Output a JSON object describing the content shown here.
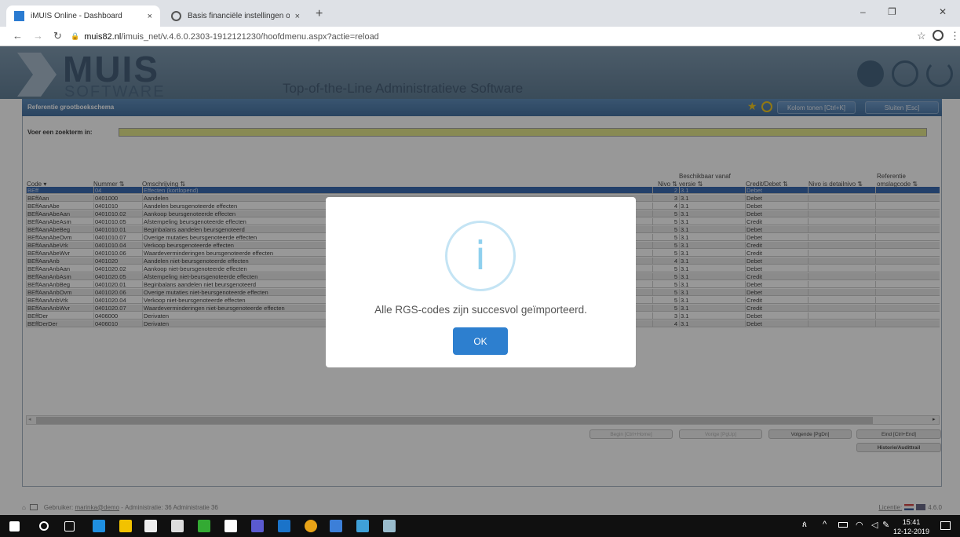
{
  "browser": {
    "tabs": [
      {
        "title": "iMUIS Online - Dashboard",
        "close": "×"
      },
      {
        "title": "Basis financiële instellingen oph",
        "close": "×"
      }
    ],
    "new_tab": "+",
    "url_host": "muis82.nl",
    "url_path": "/imuis_net/v.4.6.0.2303-1912121230/hoofdmenu.aspx?actie=reload",
    "window_controls": [
      "–",
      "❐",
      "✕"
    ]
  },
  "app": {
    "logo_main": "MUIS",
    "logo_sub": "SOFTWARE",
    "slogan": "Top-of-the-Line Administratieve Software"
  },
  "window": {
    "title": "Referentie grootboekschema",
    "show_columns_label": "Kolom tonen [Ctrl+K]",
    "close_label": "Sluiten [Esc]",
    "search_label": "Voer een zoekterm in:",
    "search_value": ""
  },
  "table": {
    "columns": [
      {
        "label": "Code ▾"
      },
      {
        "label": "Nummer ⇅"
      },
      {
        "label": "Omschrijving ⇅"
      },
      {
        "label": "Nivo ⇅"
      },
      {
        "label": "Beschikbaar vanaf versie ⇅"
      },
      {
        "label": "Credit/Debet ⇅"
      },
      {
        "label": "Nivo is detailnivo ⇅"
      },
      {
        "label": "Referentie omslagcode ⇅"
      }
    ],
    "rows": [
      [
        "BEff",
        "04",
        "Effecten (kortlopend)",
        "2",
        "3.1",
        "Debet"
      ],
      [
        "BEffAan",
        "0401000",
        "Aandelen",
        "3",
        "3.1",
        "Debet"
      ],
      [
        "BEffAanAbe",
        "0401010",
        "Aandelen beursgenoteerde effecten",
        "4",
        "3.1",
        "Debet"
      ],
      [
        "BEffAanAbeAan",
        "0401010.02",
        "Aankoop beursgenoteerde effecten",
        "5",
        "3.1",
        "Debet"
      ],
      [
        "BEffAanAbeAsm",
        "0401010.05",
        "Afstempeling beursgenoteerde effecten",
        "5",
        "3.1",
        "Credit"
      ],
      [
        "BEffAanAbeBeg",
        "0401010.01",
        "Beginbalans aandelen beursgenoteerd",
        "5",
        "3.1",
        "Debet"
      ],
      [
        "BEffAanAbeOvm",
        "0401010.07",
        "Overige mutaties beursgenoteerde effecten",
        "5",
        "3.1",
        "Debet"
      ],
      [
        "BEffAanAbeVrk",
        "0401010.04",
        "Verkoop beursgenoteerde effecten",
        "5",
        "3.1",
        "Credit"
      ],
      [
        "BEffAanAbeWvr",
        "0401010.06",
        "Waardeverminderingen beursgenoteerde effecten",
        "5",
        "3.1",
        "Credit"
      ],
      [
        "BEffAanAnb",
        "0401020",
        "Aandelen niet-beursgenoteerde effecten",
        "4",
        "3.1",
        "Debet"
      ],
      [
        "BEffAanAnbAan",
        "0401020.02",
        "Aankoop niet-beursgenoteerde effecten",
        "5",
        "3.1",
        "Debet"
      ],
      [
        "BEffAanAnbAsm",
        "0401020.05",
        "Afstempeling niet-beursgenoteerde effecten",
        "5",
        "3.1",
        "Credit"
      ],
      [
        "BEffAanAnbBeg",
        "0401020.01",
        "Beginbalans aandelen niet beursgenoteerd",
        "5",
        "3.1",
        "Debet"
      ],
      [
        "BEffAanAnbOvm",
        "0401020.06",
        "Overige mutaties niet-beursgenoteerde effecten",
        "5",
        "3.1",
        "Debet"
      ],
      [
        "BEffAanAnbVrk",
        "0401020.04",
        "Verkoop niet-beursgenoteerde effecten",
        "5",
        "3.1",
        "Credit"
      ],
      [
        "BEffAanAnbWvr",
        "0401020.07",
        "Waardeverminderingen niet-beursgenoteerde effecten",
        "5",
        "3.1",
        "Credit"
      ],
      [
        "BEffDer",
        "0406000",
        "Derivaten",
        "3",
        "3.1",
        "Debet"
      ],
      [
        "BEffDerDer",
        "0406010",
        "Derivaten",
        "4",
        "3.1",
        "Debet"
      ]
    ],
    "selected_row": 0
  },
  "pager": {
    "begin": "Begin [Ctrl+Home]",
    "prev": "Vorige [PgUp]",
    "next": "Volgende [PgDn]",
    "end": "Eind [Ctrl+End]",
    "history": "Historie/Audittrail"
  },
  "status": {
    "user_label": "Gebruiker:",
    "user": "marinka@demo",
    "admin_label": "Administratie:",
    "admin": "36 Administratie 36",
    "license": "Licentie:",
    "version": "4.6.0"
  },
  "modal": {
    "icon_glyph": "i",
    "message": "Alle RGS-codes zijn succesvol geïmporteerd.",
    "ok_label": "OK"
  },
  "taskbar": {
    "time": "15:41",
    "date": "12-12-2019"
  },
  "colors": {
    "selected_row": "#1f57a8",
    "search_bg": "#e1e47c",
    "ok_button": "#2d7fcf",
    "window_bar": "#2e5f95"
  }
}
